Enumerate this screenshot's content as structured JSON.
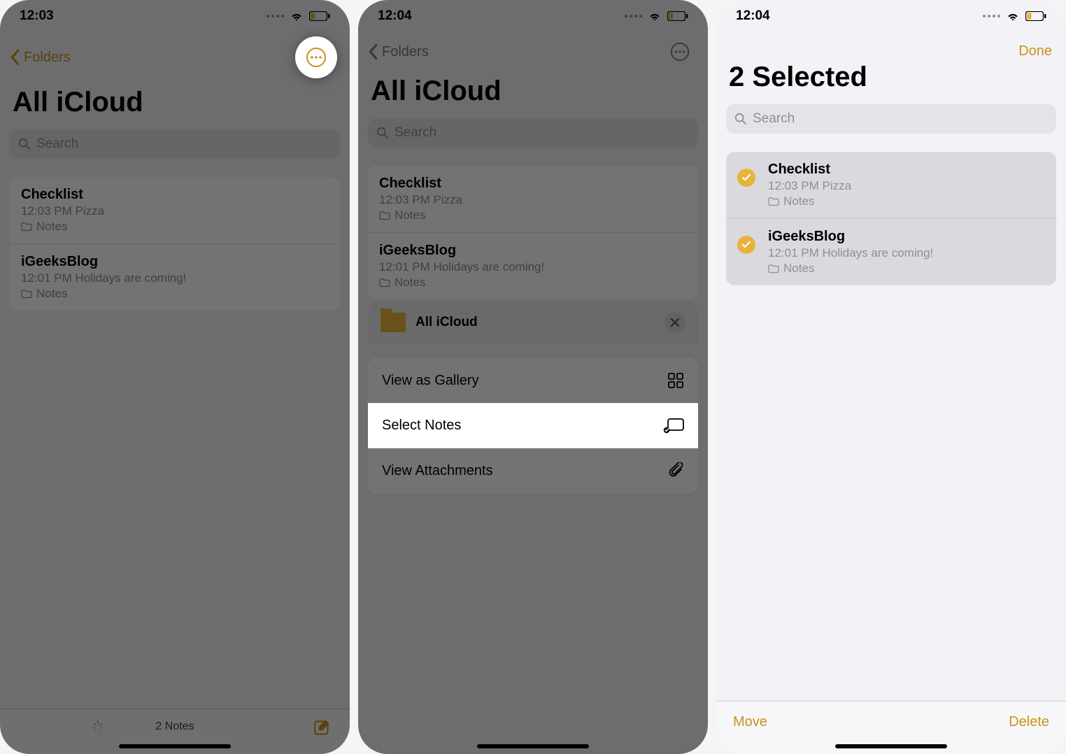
{
  "accent": "#c9921c",
  "screen1": {
    "time": "12:03",
    "back_label": "Folders",
    "title": "All iCloud",
    "search_placeholder": "Search",
    "notes": [
      {
        "title": "Checklist",
        "sub": "12:03 PM  Pizza",
        "folder": "Notes"
      },
      {
        "title": "iGeeksBlog",
        "sub": "12:01 PM  Holidays are coming!",
        "folder": "Notes"
      }
    ],
    "count_label": "2 Notes"
  },
  "screen2": {
    "time": "12:04",
    "back_label": "Folders",
    "title": "All iCloud",
    "search_placeholder": "Search",
    "notes": [
      {
        "title": "Checklist",
        "sub": "12:03 PM  Pizza",
        "folder": "Notes"
      },
      {
        "title": "iGeeksBlog",
        "sub": "12:01 PM  Holidays are coming!",
        "folder": "Notes"
      }
    ],
    "sheet": {
      "folder_name": "All iCloud",
      "items": [
        {
          "label": "View as Gallery",
          "icon": "grid-icon"
        },
        {
          "label": "Select Notes",
          "icon": "select-icon"
        },
        {
          "label": "View Attachments",
          "icon": "paperclip-icon"
        }
      ]
    }
  },
  "screen3": {
    "time": "12:04",
    "done_label": "Done",
    "title": "2 Selected",
    "search_placeholder": "Search",
    "notes": [
      {
        "title": "Checklist",
        "sub": "12:03 PM  Pizza",
        "folder": "Notes",
        "selected": true
      },
      {
        "title": "iGeeksBlog",
        "sub": "12:01 PM  Holidays are coming!",
        "folder": "Notes",
        "selected": true
      }
    ],
    "move_label": "Move",
    "delete_label": "Delete"
  }
}
